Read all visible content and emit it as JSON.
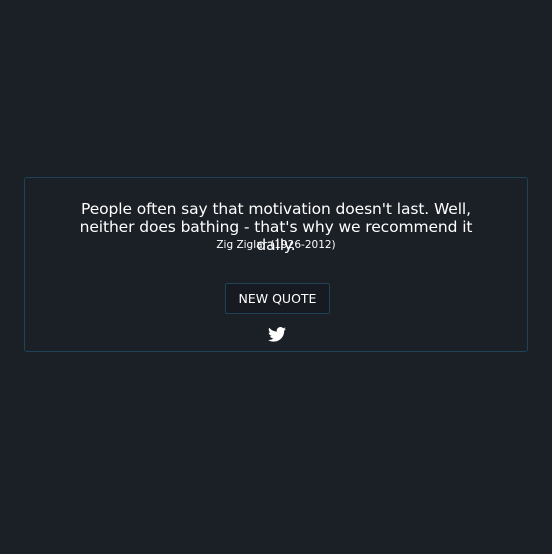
{
  "quote": {
    "text": "People often say that motivation doesn't last. Well, neither does bathing - that's why we recommend it daily.",
    "author": "Zig Ziglar (1926-2012)"
  },
  "actions": {
    "new_quote_label": "NEW QUOTE",
    "tweet_icon": "twitter-icon"
  },
  "colors": {
    "background": "#1b1f26",
    "border": "#1f4256",
    "text": "#ffffff"
  }
}
